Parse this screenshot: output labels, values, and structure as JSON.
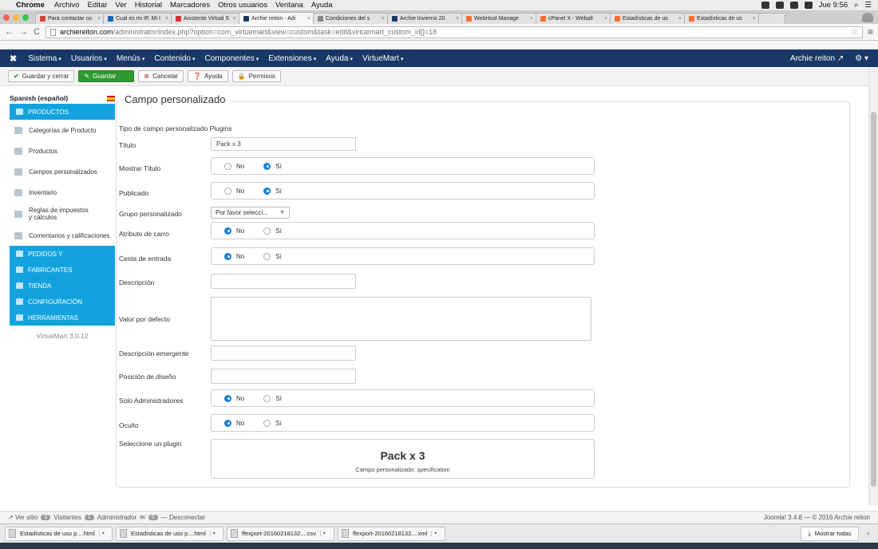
{
  "mac_menubar": {
    "app_name": "Chrome",
    "menus": [
      "Archivo",
      "Editar",
      "Ver",
      "Historial",
      "Marcadores",
      "Otros usuarios",
      "Ventana",
      "Ayuda"
    ],
    "clock": "Jue 9:56"
  },
  "tabs": [
    {
      "title": "Para contactar co",
      "color": "#d44638",
      "active": false
    },
    {
      "title": "Cual es mi IP, Mi I",
      "color": "#1565c0",
      "active": false
    },
    {
      "title": "Asistente Virtual S",
      "color": "#d32f2f",
      "active": false
    },
    {
      "title": "Archie reiton - Adi",
      "color": "#1a3867",
      "active": true
    },
    {
      "title": "Condiciones del s",
      "color": "#888888",
      "active": false
    },
    {
      "title": "Archie Invierno 20",
      "color": "#1a3867",
      "active": false
    },
    {
      "title": "WebHost Manage",
      "color": "#ff6c2c",
      "active": false
    },
    {
      "title": "cPanel X - Webalt",
      "color": "#ff6c2c",
      "active": false
    },
    {
      "title": "Estadísticas de us",
      "color": "#ff6c2c",
      "active": false
    },
    {
      "title": "Estadísticas de us",
      "color": "#ff6c2c",
      "active": false
    }
  ],
  "address": {
    "host": "archiereiton.com",
    "path": "/administrator/index.php?option=com_virtuemart&view=custom&task=edit&virtuemart_custom_id[]=18"
  },
  "navbar": {
    "items": [
      "Sistema",
      "Usuarios",
      "Menús",
      "Contenido",
      "Componentes",
      "Extensiones",
      "Ayuda",
      "VirtueMart"
    ],
    "user": "Archie reiton"
  },
  "toolbar": {
    "save_close": "Guardar y cerrar",
    "save": "Guardar",
    "cancel": "Cancelar",
    "help": "Ayuda",
    "permissions": "Permisos"
  },
  "sidebar": {
    "language": "Spanish (español)",
    "products_header": "PRODUCTOS",
    "items": [
      "Categorías de Producto",
      "Productos",
      "Campos personalizados",
      "Inventario",
      "Reglas de impuestos y cálculos",
      "Comentarios y calificaciones"
    ],
    "sections": [
      "PEDIDOS Y",
      "FABRICANTES",
      "TIENDA",
      "CONFIGURACIÓN",
      "HERRAMIENTAS"
    ],
    "version": "VirtueMart 3.0.12"
  },
  "form": {
    "legend": "Campo personalizado",
    "type_label": "Tipo de campo personalizado",
    "type_value": "Plugins",
    "title_label": "Título",
    "title_value": "Pack x 3",
    "show_title_label": "Mostrar Título",
    "published_label": "Publicado",
    "group_label": "Grupo personalizado",
    "group_value": "Por favor selecci...",
    "cart_attr_label": "Atributo de carro",
    "cart_input_label": "Cesta de entrada",
    "description_label": "Descripción",
    "default_label": "Valor por defecto",
    "tooltip_label": "Descripción emergente",
    "layout_pos_label": "Posición de diseño",
    "admin_only_label": "Solo Administradores",
    "hidden_label": "Oculto",
    "plugin_label": "Seleccione un plugin",
    "no": "No",
    "yes": "Sí",
    "plugin_title": "Pack x 3",
    "plugin_sub": "Campo personalizado: specification"
  },
  "status": {
    "view_site": "Ver sitio",
    "visitors_count": "0",
    "visitors": "Visitantes",
    "admins_count": "1",
    "admins": "Administrador",
    "messages_count": "0",
    "logout": "Desconectar",
    "copyright": "Joomla! 3.4.8 — © 2016 Archie reiton"
  },
  "downloads": {
    "files": [
      "Estadísticas de uso p....html",
      "Estadísticas de uso p....html",
      "ffexport-20160218132....csv",
      "ffexport-20160218132....xml"
    ],
    "show_all": "Mostrar todas"
  }
}
